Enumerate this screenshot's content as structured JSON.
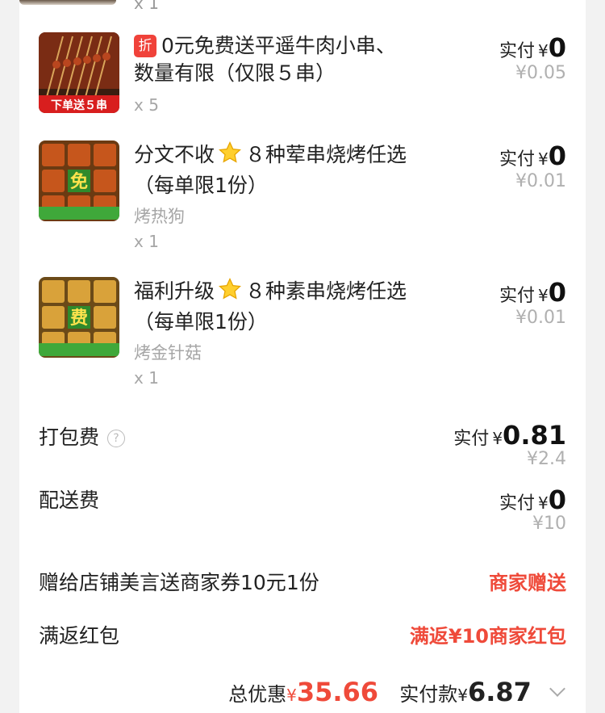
{
  "prev_item": {
    "qty": "x 1"
  },
  "items": [
    {
      "tag": "折",
      "title": "0元免费送平遥牛肉小串、数量有限（仅限５串）",
      "thumb_text": "下单送５串",
      "sub": "",
      "qty": "x 5",
      "pay_label": "实付",
      "pay_yen": "¥",
      "pay_value": "0",
      "orig": "¥0.05"
    },
    {
      "title_a": "分文不收",
      "title_b": "８种荤串烧烤任选（每单限1份）",
      "thumb_text": "免",
      "sub": "烤热狗",
      "qty": "x 1",
      "pay_label": "实付",
      "pay_yen": "¥",
      "pay_value": "0",
      "orig": "¥0.01"
    },
    {
      "title_a": "福利升级",
      "title_b": "８种素串烧烤任选（每单限1份）",
      "thumb_text": "费",
      "sub": "烤金针菇",
      "qty": "x 1",
      "pay_label": "实付",
      "pay_yen": "¥",
      "pay_value": "0",
      "orig": "¥0.01"
    }
  ],
  "packing": {
    "label": "打包费",
    "help_icon": "question-circle-icon",
    "pay_label": "实付",
    "pay_yen": "¥",
    "pay_value": "0.81",
    "orig": "¥2.4"
  },
  "delivery": {
    "label": "配送费",
    "pay_label": "实付",
    "pay_yen": "¥",
    "pay_value": "0",
    "orig": "¥10"
  },
  "gift": {
    "label": "赠给店铺美言送商家券10元1份",
    "value": "商家赠送"
  },
  "redpacket": {
    "label": "满返红包",
    "value": "满返¥10商家红包"
  },
  "footer": {
    "discount_label": "总优惠",
    "discount_yen": "¥",
    "discount_value": "35.66",
    "total_label": "实付款",
    "total_yen": "¥",
    "total_value": "6.87"
  },
  "colors": {
    "accent_red": "#ef4a3a",
    "tag_red": "#f0423a",
    "muted": "#a6a6a6"
  }
}
